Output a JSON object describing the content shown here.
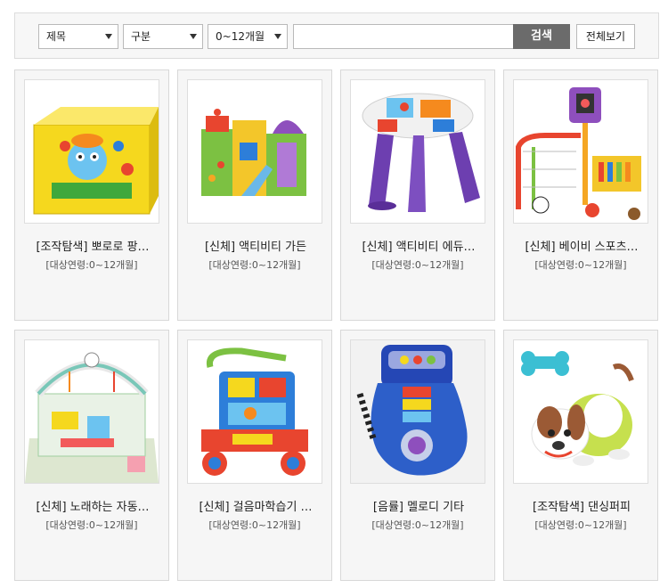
{
  "search": {
    "field_select": "제목",
    "category_select": "구분",
    "age_select": "0~12개월",
    "query_value": "",
    "search_label": "검색",
    "view_all_label": "전체보기"
  },
  "products": [
    {
      "title": "[조작탐색] 뽀로로 팡…",
      "age": "[대상연령:0~12개월]"
    },
    {
      "title": "[신체] 액티비티 가든",
      "age": "[대상연령:0~12개월]"
    },
    {
      "title": "[신체] 액티비티 에듀…",
      "age": "[대상연령:0~12개월]"
    },
    {
      "title": "[신체] 베이비 스포츠…",
      "age": "[대상연령:0~12개월]"
    },
    {
      "title": "[신체] 노래하는 자동…",
      "age": "[대상연령:0~12개월]"
    },
    {
      "title": "[신체] 걸음마학습기 …",
      "age": "[대상연령:0~12개월]"
    },
    {
      "title": "[음률] 멜로디 기타",
      "age": "[대상연령:0~12개월]"
    },
    {
      "title": "[조작탐색] 댄싱퍼피",
      "age": "[대상연령:0~12개월]"
    }
  ]
}
